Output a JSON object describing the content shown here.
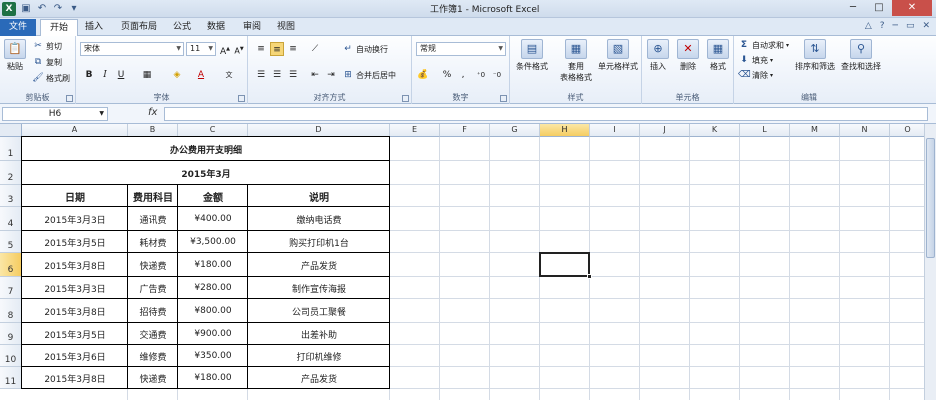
{
  "window": {
    "title": "工作簿1 - Microsoft Excel",
    "logo": "X"
  },
  "tabs": [
    "文件",
    "开始",
    "插入",
    "页面布局",
    "公式",
    "数据",
    "审阅",
    "视图"
  ],
  "ribbon": {
    "clipboard": {
      "paste": "粘贴",
      "cut": "剪切",
      "copy": "复制",
      "format_painter": "格式刷",
      "label": "剪贴板"
    },
    "font": {
      "name": "宋体",
      "size": "11",
      "bold": "B",
      "italic": "I",
      "underline": "U",
      "label": "字体"
    },
    "alignment": {
      "wrap": "自动换行",
      "merge": "合并后居中",
      "label": "对齐方式"
    },
    "number": {
      "format": "常规",
      "percent": "%",
      "comma": ",",
      "label": "数字"
    },
    "styles": {
      "conditional": "条件格式",
      "table_line1": "套用",
      "table_line2": "表格格式",
      "cell_styles": "单元格样式",
      "label": "样式"
    },
    "cells": {
      "insert": "插入",
      "delete": "删除",
      "format": "格式",
      "label": "单元格"
    },
    "editing": {
      "autosum": "自动求和",
      "fill": "填充",
      "clear": "清除",
      "sort": "排序和筛选",
      "find": "查找和选择",
      "label": "编辑"
    }
  },
  "formula_bar": {
    "name_box": "H6",
    "fx": "fx",
    "content": ""
  },
  "columns": [
    "A",
    "B",
    "C",
    "D",
    "E",
    "F",
    "G",
    "H",
    "I",
    "J",
    "K",
    "L",
    "M",
    "N",
    "O"
  ],
  "selected_column": "H",
  "selected_row": "6",
  "rows": [
    "1",
    "2",
    "3",
    "4",
    "5",
    "6",
    "7",
    "8",
    "9",
    "10",
    "11"
  ],
  "sheet": {
    "title": "办公费用开支明细",
    "subtitle": "2015年3月",
    "headers": [
      "日期",
      "费用科目",
      "金额",
      "说明"
    ],
    "records": [
      [
        "2015年3月3日",
        "通讯费",
        "¥400.00",
        "缴纳电话费"
      ],
      [
        "2015年3月5日",
        "耗材费",
        "¥3,500.00",
        "购买打印机1台"
      ],
      [
        "2015年3月8日",
        "快递费",
        "¥180.00",
        "产品发货"
      ],
      [
        "2015年3月3日",
        "广告费",
        "¥280.00",
        "制作宣传海报"
      ],
      [
        "2015年3月8日",
        "招待费",
        "¥800.00",
        "公司员工聚餐"
      ],
      [
        "2015年3月5日",
        "交通费",
        "¥900.00",
        "出差补助"
      ],
      [
        "2015年3月6日",
        "维修费",
        "¥350.00",
        "打印机维修"
      ],
      [
        "2015年3月8日",
        "快递费",
        "¥180.00",
        "产品发货"
      ]
    ]
  }
}
